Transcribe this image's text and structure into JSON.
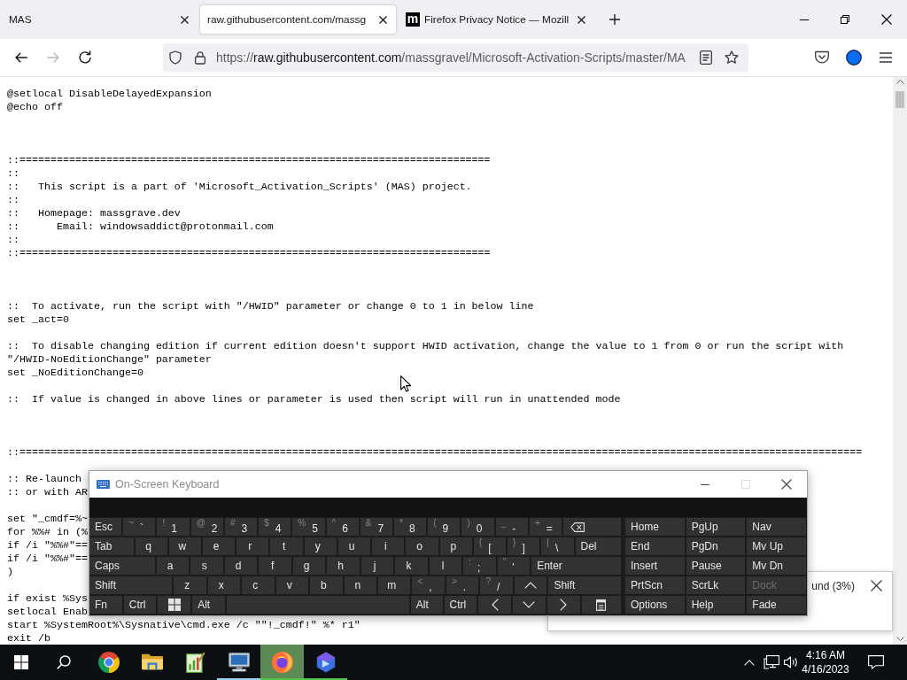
{
  "browser": {
    "tabs": [
      {
        "title": "MAS",
        "selected": false
      },
      {
        "title": "raw.githubusercontent.com/massg",
        "selected": true
      },
      {
        "title": "Firefox Privacy Notice — Mozill",
        "selected": false,
        "favicon": "m"
      }
    ],
    "nav_buttons": [
      {
        "kind": "back",
        "disabled": false
      },
      {
        "kind": "forward",
        "disabled": true
      },
      {
        "kind": "reload",
        "disabled": false
      }
    ],
    "address": {
      "scheme": "https://",
      "host": "raw.githubusercontent.com",
      "path": "/massgravel/Microsoft-Activation-Scripts/master/MA"
    }
  },
  "code_lines": [
    {
      "kind": "code",
      "text": "@setlocal DisableDelayedExpansion"
    },
    {
      "kind": "code",
      "text": "@echo off"
    },
    {
      "kind": "blank"
    },
    {
      "kind": "blank"
    },
    {
      "kind": "blank"
    },
    {
      "kind": "code",
      "text": "::============================================================================"
    },
    {
      "kind": "code",
      "text": "::"
    },
    {
      "kind": "code",
      "text": "::   This script is a part of 'Microsoft_Activation_Scripts' (MAS) project."
    },
    {
      "kind": "code",
      "text": "::"
    },
    {
      "kind": "code",
      "text": "::   Homepage: massgrave.dev"
    },
    {
      "kind": "code",
      "text": "::      Email: windowsaddict@protonmail.com"
    },
    {
      "kind": "code",
      "text": "::"
    },
    {
      "kind": "code",
      "text": "::============================================================================"
    },
    {
      "kind": "blank"
    },
    {
      "kind": "blank"
    },
    {
      "kind": "blank"
    },
    {
      "kind": "code",
      "text": "::  To activate, run the script with \"/HWID\" parameter or change 0 to 1 in below line"
    },
    {
      "kind": "code",
      "text": "set _act=0"
    },
    {
      "kind": "blank"
    },
    {
      "kind": "code",
      "text": "::  To disable changing edition if current edition doesn't support HWID activation, change the value to 1 from 0 or run the script with"
    },
    {
      "kind": "code",
      "text": "\"/HWID-NoEditionChange\" parameter"
    },
    {
      "kind": "code",
      "text": "set _NoEditionChange=0"
    },
    {
      "kind": "blank"
    },
    {
      "kind": "code",
      "text": "::  If value is changed in above lines or parameter is used then script will run in unattended mode"
    },
    {
      "kind": "blank"
    },
    {
      "kind": "blank"
    },
    {
      "kind": "blank"
    },
    {
      "kind": "code",
      "text": "::========================================================================================================================================"
    },
    {
      "kind": "blank"
    },
    {
      "kind": "code",
      "text": ":: Re-launch"
    },
    {
      "kind": "code",
      "text": ":: or with AR"
    },
    {
      "kind": "blank"
    },
    {
      "kind": "code",
      "text": "set \"_cmdf=%~"
    },
    {
      "kind": "code",
      "text": "for %%# in (%"
    },
    {
      "kind": "code",
      "text": "if /i \"%%#\"=="
    },
    {
      "kind": "code",
      "text": "if /i \"%%#\"=="
    },
    {
      "kind": "code",
      "text": ")"
    },
    {
      "kind": "blank"
    },
    {
      "kind": "code",
      "text": "if exist %Sys"
    },
    {
      "kind": "code",
      "text": "setlocal Enab"
    },
    {
      "kind": "code",
      "text": "start %SystemRoot%\\Sysnative\\cmd.exe /c \"\"!_cmdf!\" %* r1\""
    },
    {
      "kind": "code",
      "text": "exit /b"
    }
  ],
  "keyboard": {
    "title": "On-Screen Keyboard",
    "window_buttons": [
      {
        "kind": "minimize",
        "disabled": false
      },
      {
        "kind": "maximize",
        "disabled": true
      },
      {
        "kind": "close",
        "disabled": false
      }
    ],
    "rows": [
      {
        "keys": [
          {
            "kind": "word",
            "label": "Esc"
          },
          {
            "kind": "dual",
            "shift": "~",
            "label": "`"
          },
          {
            "kind": "dual",
            "shift": "!",
            "label": "1"
          },
          {
            "kind": "dual",
            "shift": "@",
            "label": "2"
          },
          {
            "kind": "dual",
            "shift": "#",
            "label": "3"
          },
          {
            "kind": "dual",
            "shift": "$",
            "label": "4"
          },
          {
            "kind": "dual",
            "shift": "%",
            "label": "5"
          },
          {
            "kind": "dual",
            "shift": "^",
            "label": "6"
          },
          {
            "kind": "dual",
            "shift": "&",
            "label": "7"
          },
          {
            "kind": "dual",
            "shift": "*",
            "label": "8"
          },
          {
            "kind": "dual",
            "shift": "(",
            "label": "9"
          },
          {
            "kind": "dual",
            "shift": ")",
            "label": "0"
          },
          {
            "kind": "dual",
            "shift": "_",
            "label": "-"
          },
          {
            "kind": "dual",
            "shift": "+",
            "label": "="
          },
          {
            "kind": "backspace"
          }
        ]
      },
      {
        "keys": [
          {
            "kind": "word",
            "label": "Tab"
          },
          {
            "kind": "letter",
            "label": "q"
          },
          {
            "kind": "letter",
            "label": "w"
          },
          {
            "kind": "letter",
            "label": "e"
          },
          {
            "kind": "letter",
            "label": "r"
          },
          {
            "kind": "letter",
            "label": "t"
          },
          {
            "kind": "letter",
            "label": "y"
          },
          {
            "kind": "letter",
            "label": "u"
          },
          {
            "kind": "letter",
            "label": "i"
          },
          {
            "kind": "letter",
            "label": "o"
          },
          {
            "kind": "letter",
            "label": "p"
          },
          {
            "kind": "dual",
            "shift": "{",
            "label": "["
          },
          {
            "kind": "dual",
            "shift": "}",
            "label": "]"
          },
          {
            "kind": "dual",
            "shift": "|",
            "label": "\\"
          },
          {
            "kind": "word",
            "label": "Del"
          }
        ]
      },
      {
        "keys": [
          {
            "kind": "word",
            "label": "Caps"
          },
          {
            "kind": "letter",
            "label": "a"
          },
          {
            "kind": "letter",
            "label": "s"
          },
          {
            "kind": "letter",
            "label": "d"
          },
          {
            "kind": "letter",
            "label": "f"
          },
          {
            "kind": "letter",
            "label": "g"
          },
          {
            "kind": "letter",
            "label": "h"
          },
          {
            "kind": "letter",
            "label": "j"
          },
          {
            "kind": "letter",
            "label": "k"
          },
          {
            "kind": "letter",
            "label": "l"
          },
          {
            "kind": "dual",
            "shift": ":",
            "label": ";"
          },
          {
            "kind": "dual",
            "shift": "\"",
            "label": "'"
          },
          {
            "kind": "word",
            "label": "Enter"
          }
        ]
      },
      {
        "keys": [
          {
            "kind": "word",
            "label": "Shift"
          },
          {
            "kind": "letter",
            "label": "z"
          },
          {
            "kind": "letter",
            "label": "x"
          },
          {
            "kind": "letter",
            "label": "c"
          },
          {
            "kind": "letter",
            "label": "v"
          },
          {
            "kind": "letter",
            "label": "b"
          },
          {
            "kind": "letter",
            "label": "n"
          },
          {
            "kind": "letter",
            "label": "m"
          },
          {
            "kind": "dual",
            "shift": "<",
            "label": ","
          },
          {
            "kind": "dual",
            "shift": ">",
            "label": "."
          },
          {
            "kind": "dual",
            "shift": "?",
            "label": "/"
          },
          {
            "kind": "up"
          },
          {
            "kind": "word",
            "label": "Shift"
          }
        ]
      },
      {
        "keys": [
          {
            "kind": "word",
            "label": "Fn"
          },
          {
            "kind": "word",
            "label": "Ctrl"
          },
          {
            "kind": "windows"
          },
          {
            "kind": "word",
            "label": "Alt"
          },
          {
            "kind": "space"
          },
          {
            "kind": "word",
            "label": "Alt"
          },
          {
            "kind": "word",
            "label": "Ctrl"
          },
          {
            "kind": "left"
          },
          {
            "kind": "down"
          },
          {
            "kind": "right"
          },
          {
            "kind": "menu"
          }
        ]
      }
    ],
    "side_keys": [
      {
        "label": "Home",
        "disabled": false
      },
      {
        "label": "PgUp",
        "disabled": false
      },
      {
        "label": "Nav",
        "disabled": false
      },
      {
        "label": "End",
        "disabled": false
      },
      {
        "label": "PgDn",
        "disabled": false
      },
      {
        "label": "Mv Up",
        "disabled": false
      },
      {
        "label": "Insert",
        "disabled": false
      },
      {
        "label": "Pause",
        "disabled": false
      },
      {
        "label": "Mv Dn",
        "disabled": false
      },
      {
        "label": "PrtScn",
        "disabled": false
      },
      {
        "label": "ScrLk",
        "disabled": false
      },
      {
        "label": "Dock",
        "disabled": true
      },
      {
        "label": "Options",
        "disabled": false
      },
      {
        "label": "Help",
        "disabled": false
      },
      {
        "label": "Fade",
        "disabled": false
      }
    ]
  },
  "notification": {
    "text": "und (3%)"
  },
  "taskbar": {
    "apps": [
      {
        "kind": "chrome",
        "running": false,
        "selected": false
      },
      {
        "kind": "folder",
        "running": false,
        "selected": false
      },
      {
        "kind": "chart",
        "running": false,
        "selected": false
      },
      {
        "kind": "computer",
        "running": true,
        "selected": false,
        "color": "#9bd3f2"
      },
      {
        "kind": "firefox",
        "running": true,
        "selected": true,
        "color": "#4fc64a"
      },
      {
        "kind": "blueapp",
        "running": true,
        "selected": false,
        "color": "#4fc64a"
      }
    ],
    "clock": {
      "time": "4:16 AM",
      "date": "4/16/2023"
    }
  }
}
